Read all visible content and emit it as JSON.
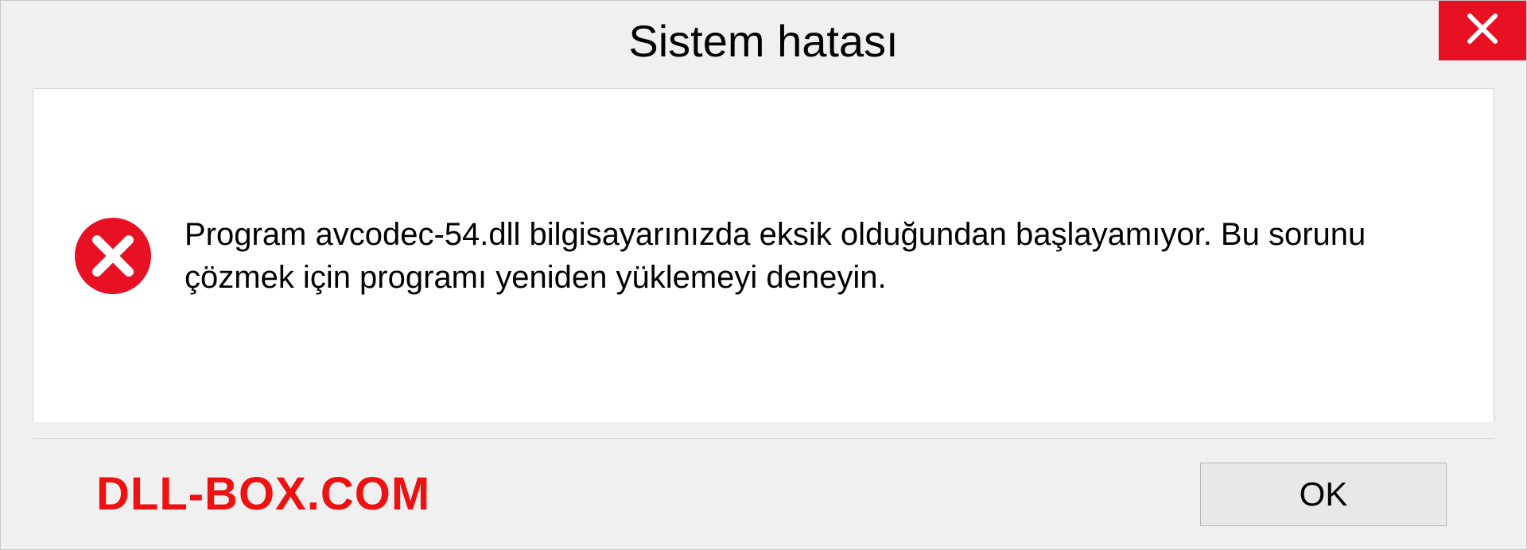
{
  "dialog": {
    "title": "Sistem hatası",
    "message": "Program avcodec-54.dll bilgisayarınızda eksik olduğundan başlayamıyor. Bu sorunu çözmek için programı yeniden yüklemeyi deneyin.",
    "ok_label": "OK"
  },
  "watermark": "DLL-BOX.COM",
  "colors": {
    "close_bg": "#e81123",
    "error_icon": "#e81123",
    "watermark": "#ee1111"
  }
}
